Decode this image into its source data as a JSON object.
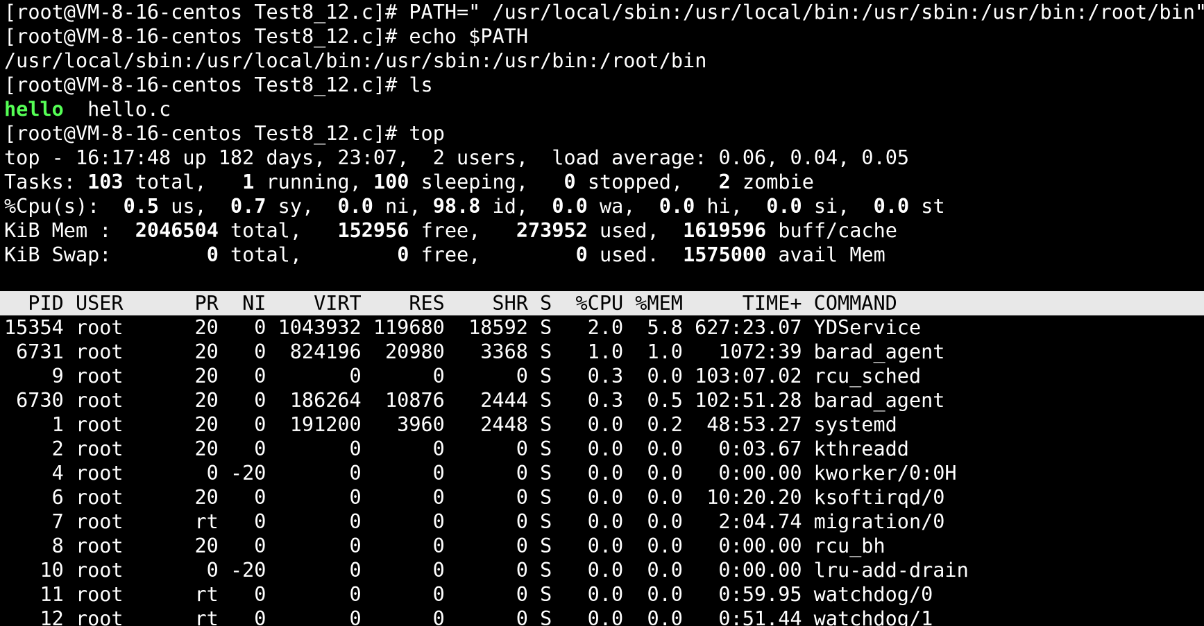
{
  "colors": {
    "background": "#000000",
    "foreground": "#ffffff",
    "executable": "#55ff55",
    "header_bg": "#e8e8e8",
    "header_fg": "#000000"
  },
  "prompt": "[root@VM-8-16-centos Test8_12.c]# ",
  "commands": {
    "path_set": "PATH=\" /usr/local/sbin:/usr/local/bin:/usr/sbin:/usr/bin:/root/bin\"",
    "echo": "echo $PATH",
    "echo_output": "/usr/local/sbin:/usr/local/bin:/usr/sbin:/usr/bin:/root/bin",
    "ls": "ls",
    "ls_exec": "hello",
    "ls_file": "hello.c",
    "top": "top"
  },
  "summary": {
    "top_line": "top - 16:17:48 up 182 days, 23:07,  2 users,  load average: 0.06, 0.04, 0.05",
    "tasks": {
      "label": "Tasks: ",
      "total": "103",
      "total_label": " total,   ",
      "running": "1",
      "running_label": " running, ",
      "sleeping": "100",
      "sleeping_label": " sleeping,   ",
      "stopped": "0",
      "stopped_label": " stopped,   ",
      "zombie": "2",
      "zombie_label": " zombie"
    },
    "cpu": {
      "label": "%Cpu(s):  ",
      "us": "0.5",
      "us_label": " us,  ",
      "sy": "0.7",
      "sy_label": " sy,  ",
      "ni": "0.0",
      "ni_label": " ni, ",
      "id": "98.8",
      "id_label": " id,  ",
      "wa": "0.0",
      "wa_label": " wa,  ",
      "hi": "0.0",
      "hi_label": " hi,  ",
      "si": "0.0",
      "si_label": " si,  ",
      "st": "0.0",
      "st_label": " st"
    },
    "mem": {
      "label": "KiB Mem :  ",
      "total": "2046504",
      "total_label": " total,   ",
      "free": "152956",
      "free_label": " free,   ",
      "used": "273952",
      "used_label": " used,  ",
      "buff": "1619596",
      "buff_label": " buff/cache"
    },
    "swap": {
      "label": "KiB Swap:        ",
      "total": "0",
      "total_label": " total,        ",
      "free": "0",
      "free_label": " free,        ",
      "used": "0",
      "used_label": " used.  ",
      "avail": "1575000",
      "avail_label": " avail Mem"
    }
  },
  "columns": [
    "PID",
    "USER",
    "PR",
    "NI",
    "VIRT",
    "RES",
    "SHR",
    "S",
    "%CPU",
    "%MEM",
    "TIME+",
    "COMMAND"
  ],
  "processes": [
    [
      "15354",
      "root",
      "20",
      "0",
      "1043932",
      "119680",
      "18592",
      "S",
      "2.0",
      "5.8",
      "627:23.07",
      "YDService"
    ],
    [
      "6731",
      "root",
      "20",
      "0",
      "824196",
      "20980",
      "3368",
      "S",
      "1.0",
      "1.0",
      "1072:39",
      "barad_agent"
    ],
    [
      "9",
      "root",
      "20",
      "0",
      "0",
      "0",
      "0",
      "S",
      "0.3",
      "0.0",
      "103:07.02",
      "rcu_sched"
    ],
    [
      "6730",
      "root",
      "20",
      "0",
      "186264",
      "10876",
      "2444",
      "S",
      "0.3",
      "0.5",
      "102:51.28",
      "barad_agent"
    ],
    [
      "1",
      "root",
      "20",
      "0",
      "191200",
      "3960",
      "2448",
      "S",
      "0.0",
      "0.2",
      "48:53.27",
      "systemd"
    ],
    [
      "2",
      "root",
      "20",
      "0",
      "0",
      "0",
      "0",
      "S",
      "0.0",
      "0.0",
      "0:03.67",
      "kthreadd"
    ],
    [
      "4",
      "root",
      "0",
      "-20",
      "0",
      "0",
      "0",
      "S",
      "0.0",
      "0.0",
      "0:00.00",
      "kworker/0:0H"
    ],
    [
      "6",
      "root",
      "20",
      "0",
      "0",
      "0",
      "0",
      "S",
      "0.0",
      "0.0",
      "10:20.20",
      "ksoftirqd/0"
    ],
    [
      "7",
      "root",
      "rt",
      "0",
      "0",
      "0",
      "0",
      "S",
      "0.0",
      "0.0",
      "2:04.74",
      "migration/0"
    ],
    [
      "8",
      "root",
      "20",
      "0",
      "0",
      "0",
      "0",
      "S",
      "0.0",
      "0.0",
      "0:00.00",
      "rcu_bh"
    ],
    [
      "10",
      "root",
      "0",
      "-20",
      "0",
      "0",
      "0",
      "S",
      "0.0",
      "0.0",
      "0:00.00",
      "lru-add-drain"
    ],
    [
      "11",
      "root",
      "rt",
      "0",
      "0",
      "0",
      "0",
      "S",
      "0.0",
      "0.0",
      "0:59.95",
      "watchdog/0"
    ],
    [
      "12",
      "root",
      "rt",
      "0",
      "0",
      "0",
      "0",
      "S",
      "0.0",
      "0.0",
      "0:51.44",
      "watchdog/1"
    ]
  ]
}
